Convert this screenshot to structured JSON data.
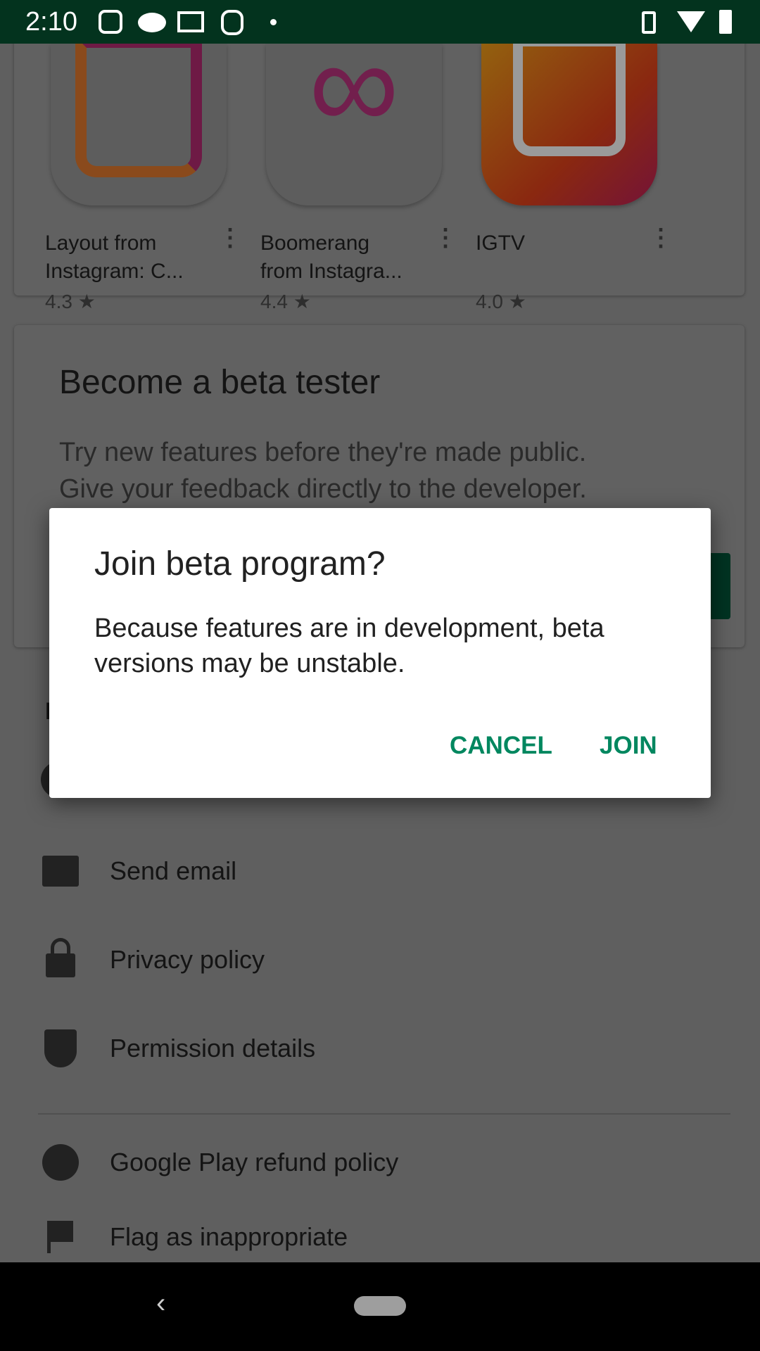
{
  "status_bar": {
    "time": "2:10",
    "notification_icons": [
      "instagram-icon",
      "reddit-icon",
      "gmail-icon",
      "alarm-app-icon",
      "dot-icon"
    ],
    "system_icons": [
      "vibrate-icon",
      "wifi-icon",
      "battery-icon"
    ]
  },
  "apps": [
    {
      "title": "Layout from Instagram: C...",
      "rating": "4.3 ★"
    },
    {
      "title": "Boomerang from Instagra...",
      "rating": "4.4 ★"
    },
    {
      "title": "IGTV",
      "rating": "4.0 ★"
    }
  ],
  "beta": {
    "title": "Become a beta tester",
    "line1": "Try new features before they're made public.",
    "line2": "Give your feedback directly to the developer."
  },
  "dev_contact": {
    "heading": "I",
    "items": [
      {
        "label": "Send email",
        "icon": "email-icon"
      },
      {
        "label": "Privacy policy",
        "icon": "lock-icon"
      },
      {
        "label": "Permission details",
        "icon": "shield-icon"
      }
    ]
  },
  "footer_items": [
    {
      "label": "Google Play refund policy",
      "icon": "refund-icon"
    },
    {
      "label": "Flag as inappropriate",
      "icon": "flag-icon"
    }
  ],
  "dialog": {
    "title": "Join beta program?",
    "body": "Because features are in development, beta versions may be unstable.",
    "cancel": "CANCEL",
    "join": "JOIN"
  },
  "colors": {
    "accent": "#01875f",
    "status_bar": "#0a8750"
  }
}
